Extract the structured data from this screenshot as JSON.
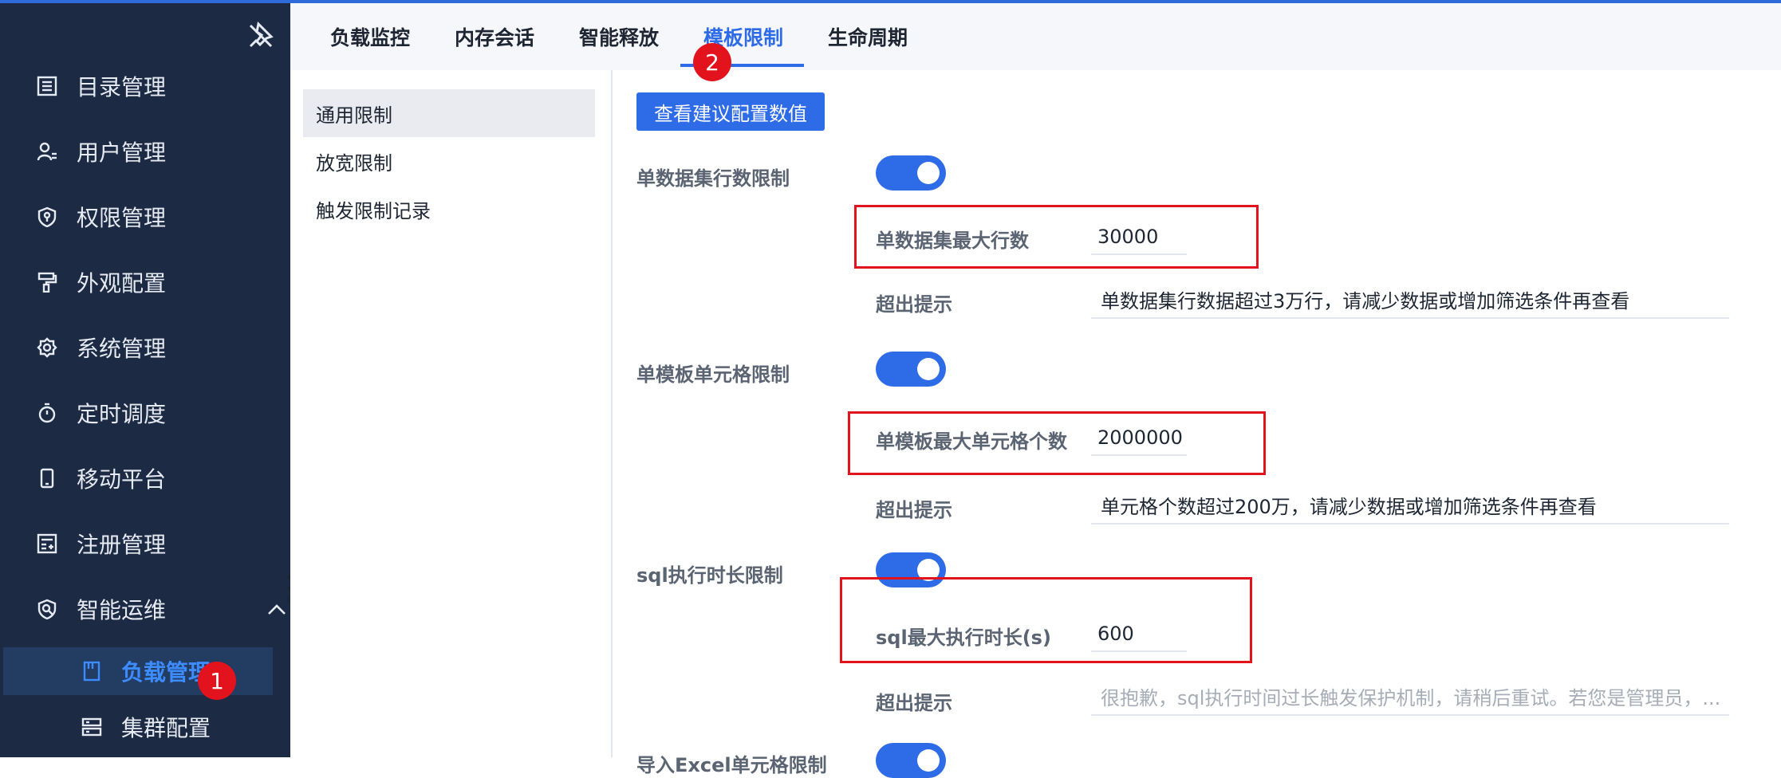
{
  "colors": {
    "accent": "#2e6be6",
    "sidebar_bg": "#1c2a43",
    "badge": "#e3131d",
    "highlight_box": "#e3131d"
  },
  "sidebar": {
    "items": [
      {
        "label": "目录管理",
        "icon": "list-icon"
      },
      {
        "label": "用户管理",
        "icon": "user-icon"
      },
      {
        "label": "权限管理",
        "icon": "shield-icon"
      },
      {
        "label": "外观配置",
        "icon": "paint-roller-icon"
      },
      {
        "label": "系统管理",
        "icon": "gear-icon"
      },
      {
        "label": "定时调度",
        "icon": "stopwatch-icon"
      },
      {
        "label": "移动平台",
        "icon": "mobile-icon"
      },
      {
        "label": "注册管理",
        "icon": "register-icon"
      },
      {
        "label": "智能运维",
        "icon": "smart-ops-icon"
      }
    ],
    "sub_items": [
      {
        "label": "负载管理",
        "icon": "card-icon"
      },
      {
        "label": "集群配置",
        "icon": "server-icon"
      }
    ]
  },
  "badges": {
    "one": "1",
    "two": "2"
  },
  "tabs": [
    {
      "label": "负载监控"
    },
    {
      "label": "内存会话"
    },
    {
      "label": "智能释放"
    },
    {
      "label": "模板限制"
    },
    {
      "label": "生命周期"
    }
  ],
  "submenu": [
    {
      "label": "通用限制"
    },
    {
      "label": "放宽限制"
    },
    {
      "label": "触发限制记录"
    }
  ],
  "main": {
    "suggest_button": "查看建议配置数值",
    "sections": [
      {
        "title": "单数据集行数限制",
        "enabled": true,
        "field_label": "单数据集最大行数",
        "field_value": "30000",
        "hint_label": "超出提示",
        "hint_value": "单数据集行数据超过3万行，请减少数据或增加筛选条件再查看"
      },
      {
        "title": "单模板单元格限制",
        "enabled": true,
        "field_label": "单模板最大单元格个数",
        "field_value": "2000000",
        "hint_label": "超出提示",
        "hint_value": "单元格个数超过200万，请减少数据或增加筛选条件再查看"
      },
      {
        "title": "sql执行时长限制",
        "enabled": true,
        "field_label": "sql最大执行时长(s)",
        "field_value": "600",
        "hint_label": "超出提示",
        "hint_placeholder": "很抱歉，sql执行时间过长触发保护机制，请稍后重试。若您是管理员，..."
      },
      {
        "title": "导入Excel单元格限制",
        "enabled": true
      }
    ]
  }
}
